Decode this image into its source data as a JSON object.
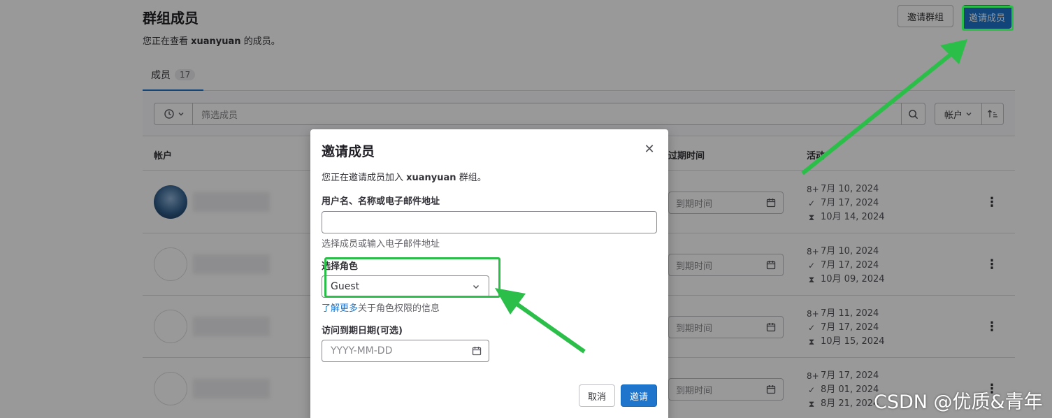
{
  "page": {
    "title": "群组成员",
    "subtitle_prefix": "您正在查看 ",
    "group_name": "xuanyuan",
    "subtitle_suffix": " 的成员。",
    "invite_group_label": "邀请群组",
    "invite_member_label": "邀请成员"
  },
  "tabs": [
    {
      "label": "成员",
      "count": "17"
    }
  ],
  "filter": {
    "placeholder": "筛选成员",
    "sort_label": "帐户"
  },
  "table": {
    "columns": {
      "account": "帐户",
      "expiration": "过期时间",
      "activity": "活动"
    },
    "rows": [
      {
        "avatar": "photo",
        "expiry_placeholder": "到期时间",
        "joined": "7月 10, 2024",
        "last_access": "7月 17, 2024",
        "expires": "10月 14, 2024"
      },
      {
        "avatar": "broken",
        "expiry_placeholder": "到期时间",
        "joined": "7月 10, 2024",
        "last_access": "7月 17, 2024",
        "expires": "10月 09, 2024"
      },
      {
        "avatar": "broken",
        "expiry_placeholder": "到期时间",
        "joined": "7月 11, 2024",
        "last_access": "7月 17, 2024",
        "expires": "10月 15, 2024"
      },
      {
        "avatar": "broken",
        "expiry_placeholder": "到期时间",
        "joined": "7月 17, 2024",
        "last_access": "8月 01, 2024",
        "expires": "8月 21, 2024"
      }
    ]
  },
  "modal": {
    "title": "邀请成员",
    "intro_prefix": "您正在邀请成员加入 ",
    "group_name": "xuanyuan",
    "intro_suffix": " 群组。",
    "username_label": "用户名、名称或电子邮件地址",
    "username_value": "",
    "username_help": "选择成员或输入电子邮件地址",
    "role_label": "选择角色",
    "role_value": "Guest",
    "role_help_link": "了解更多",
    "role_help_text": "关于角色权限的信息",
    "expiry_label": "访问到期日期(可选)",
    "expiry_placeholder": "YYYY-MM-DD",
    "cancel_label": "取消",
    "invite_label": "邀请"
  },
  "watermark": "CSDN @优质&青年",
  "colors": {
    "accent": "#1f75cb",
    "highlight": "#2bbf4a"
  }
}
